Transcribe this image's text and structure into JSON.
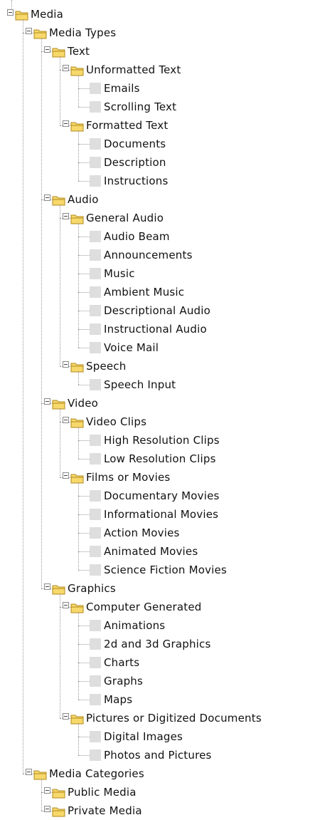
{
  "tree": {
    "label": "Media",
    "children": [
      {
        "label": "Media Types",
        "children": [
          {
            "label": "Text",
            "children": [
              {
                "label": "Unformatted Text",
                "children": [
                  {
                    "label": "Emails"
                  },
                  {
                    "label": "Scrolling Text"
                  }
                ]
              },
              {
                "label": "Formatted Text",
                "children": [
                  {
                    "label": "Documents"
                  },
                  {
                    "label": "Description"
                  },
                  {
                    "label": "Instructions"
                  }
                ]
              }
            ]
          },
          {
            "label": "Audio",
            "children": [
              {
                "label": "General Audio",
                "children": [
                  {
                    "label": "Audio Beam"
                  },
                  {
                    "label": "Announcements"
                  },
                  {
                    "label": "Music"
                  },
                  {
                    "label": "Ambient Music"
                  },
                  {
                    "label": "Descriptional Audio"
                  },
                  {
                    "label": "Instructional Audio"
                  },
                  {
                    "label": "Voice Mail"
                  }
                ]
              },
              {
                "label": "Speech",
                "children": [
                  {
                    "label": "Speech Input"
                  }
                ]
              }
            ]
          },
          {
            "label": "Video",
            "children": [
              {
                "label": "Video Clips",
                "children": [
                  {
                    "label": "High Resolution Clips"
                  },
                  {
                    "label": "Low Resolution Clips"
                  }
                ]
              },
              {
                "label": "Films or Movies",
                "children": [
                  {
                    "label": "Documentary Movies"
                  },
                  {
                    "label": "Informational Movies"
                  },
                  {
                    "label": "Action Movies"
                  },
                  {
                    "label": "Animated Movies"
                  },
                  {
                    "label": "Science Fiction Movies"
                  }
                ]
              }
            ]
          },
          {
            "label": "Graphics",
            "children": [
              {
                "label": "Computer Generated",
                "children": [
                  {
                    "label": "Animations"
                  },
                  {
                    "label": "2d and 3d Graphics"
                  },
                  {
                    "label": "Charts"
                  },
                  {
                    "label": "Graphs"
                  },
                  {
                    "label": "Maps"
                  }
                ]
              },
              {
                "label": "Pictures or Digitized Documents",
                "children": [
                  {
                    "label": "Digital Images"
                  },
                  {
                    "label": "Photos and Pictures"
                  }
                ]
              }
            ]
          }
        ]
      },
      {
        "label": "Media Categories",
        "children": [
          {
            "label": "Public Media",
            "children": []
          },
          {
            "label": "Private Media",
            "children": []
          }
        ]
      }
    ]
  },
  "icons": {
    "expanded": "minus-toggle-icon",
    "folder": "folder-icon",
    "leaf": "item-box-icon"
  },
  "colors": {
    "folder_fill": "#f7d86a",
    "folder_stroke": "#b08a1e",
    "leaf_box": "#dedede",
    "connector": "#9a9a9a"
  }
}
